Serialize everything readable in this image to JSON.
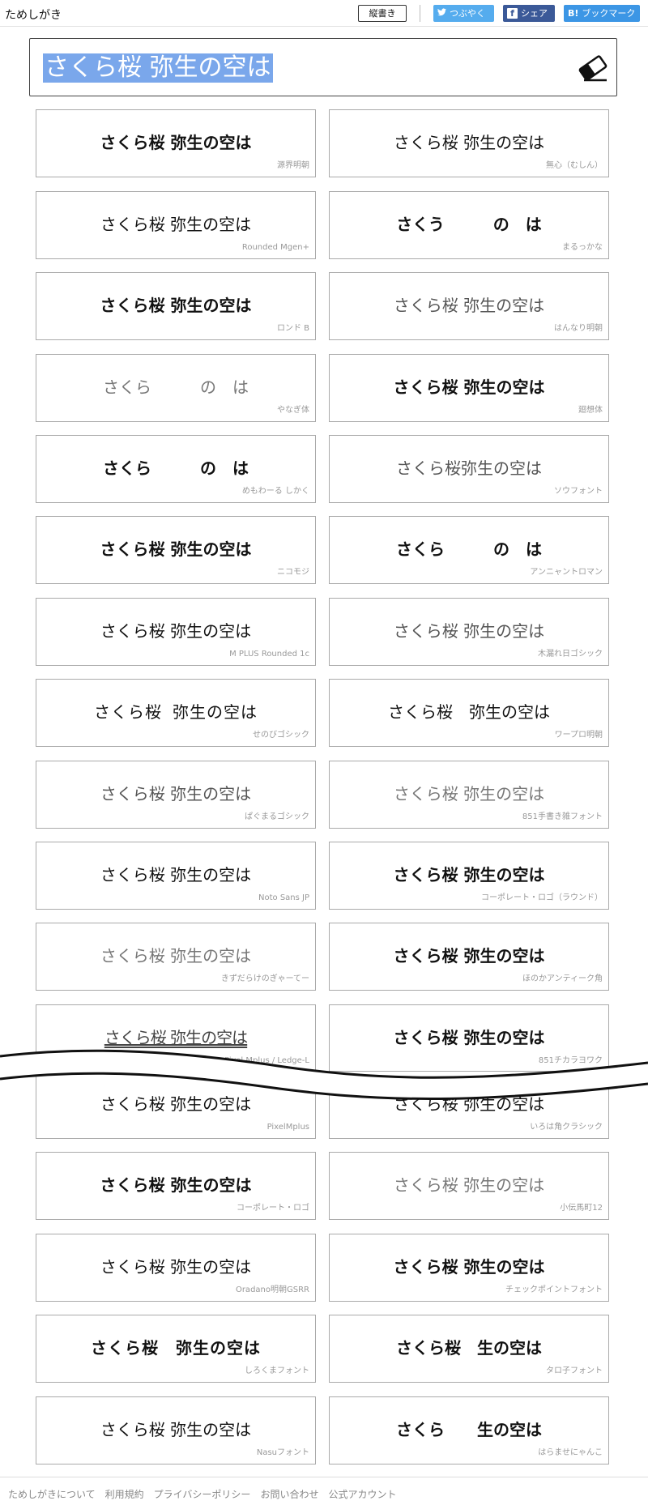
{
  "header": {
    "logo": "ためしがき",
    "vertical_button": "縦書き",
    "share_twitter": "つぶやく",
    "share_facebook": "シェア",
    "share_hatena": "ブックマーク",
    "twitter_icon": "twitter-bird-icon",
    "facebook_icon": "facebook-icon",
    "hatena_icon": "hatena-bookmark-icon"
  },
  "input": {
    "text": "さくら桜 弥生の空は",
    "eraser_icon": "eraser-icon",
    "highlight_color": "#7aa7eb"
  },
  "cards": [
    {
      "sample": "さくら桜 弥生の空は",
      "font": "源界明朝"
    },
    {
      "sample": "さくら桜 弥生の空は",
      "font": "無心（むしん）"
    },
    {
      "sample": "さくら桜 弥生の空は",
      "font": "Rounded Mgen+"
    },
    {
      "sample": "さくう　　　の　は",
      "font": "まるっかな"
    },
    {
      "sample": "さくら桜 弥生の空は",
      "font": "ロンド B"
    },
    {
      "sample": "さくら桜 弥生の空は",
      "font": "はんなり明朝"
    },
    {
      "sample": "さくら　　　の　は",
      "font": "やなぎ体"
    },
    {
      "sample": "さくら桜 弥生の空は",
      "font": "廻想体"
    },
    {
      "sample": "さくら　　　の　は",
      "font": "めもわーる しかく"
    },
    {
      "sample": "さくら桜弥生の空は",
      "font": "ソウフォント"
    },
    {
      "sample": "さくら桜 弥生の空は",
      "font": "ニコモジ"
    },
    {
      "sample": "さくら　　　の　は",
      "font": "アンニャントロマン"
    },
    {
      "sample": "さくら桜 弥生の空は",
      "font": "M PLUS Rounded 1c"
    },
    {
      "sample": "さくら桜 弥生の空は",
      "font": "木漏れ日ゴシック"
    },
    {
      "sample": "さくら桜 弥生の空は",
      "font": "せのびゴシック"
    },
    {
      "sample": "さくら桜　弥生の空は",
      "font": "ワープロ明朝"
    },
    {
      "sample": "さくら桜 弥生の空は",
      "font": "ぱぐまるゴシック"
    },
    {
      "sample": "さくら桜 弥生の空は",
      "font": "851手書き雑フォント"
    },
    {
      "sample": "さくら桜 弥生の空は",
      "font": "Noto Sans JP"
    },
    {
      "sample": "さくら桜 弥生の空は",
      "font": "コーポレート・ロゴ（ラウンド）"
    },
    {
      "sample": "さくら桜 弥生の空は",
      "font": "きずだらけのぎゃーてー"
    },
    {
      "sample": "さくら桜 弥生の空は",
      "font": "ほのかアンティーク角"
    },
    {
      "sample": "さくら桜 弥生の空は",
      "font": "Pixel Mplus / Ledge-L"
    },
    {
      "sample": "さくら桜 弥生の空は",
      "font": "851チカラヨワク"
    },
    {
      "sample": "さくら桜 弥生の空は",
      "font": "PixelMplus"
    },
    {
      "sample": "さくら桜 弥生の空は",
      "font": "いろは角クラシック"
    },
    {
      "sample": "さくら桜 弥生の空は",
      "font": "コーポレート・ロゴ"
    },
    {
      "sample": "さくら桜 弥生の空は",
      "font": "小伝馬町12"
    },
    {
      "sample": "さくら桜 弥生の空は",
      "font": "Oradano明朝GSRR"
    },
    {
      "sample": "さくら桜 弥生の空は",
      "font": "チェックポイントフォント"
    },
    {
      "sample": "さくら桜　弥生の空は",
      "font": "しろくまフォント"
    },
    {
      "sample": "さくら桜　生の空は",
      "font": "タロ子フォント"
    },
    {
      "sample": "さくら桜 弥生の空は",
      "font": "Nasuフォント"
    },
    {
      "sample": "さくら　　生の空は",
      "font": "はらませにゃんこ"
    }
  ],
  "footer": {
    "links": [
      "ためしがきについて",
      "利用規約",
      "プライバシーポリシー",
      "お問い合わせ",
      "公式アカウント"
    ]
  }
}
